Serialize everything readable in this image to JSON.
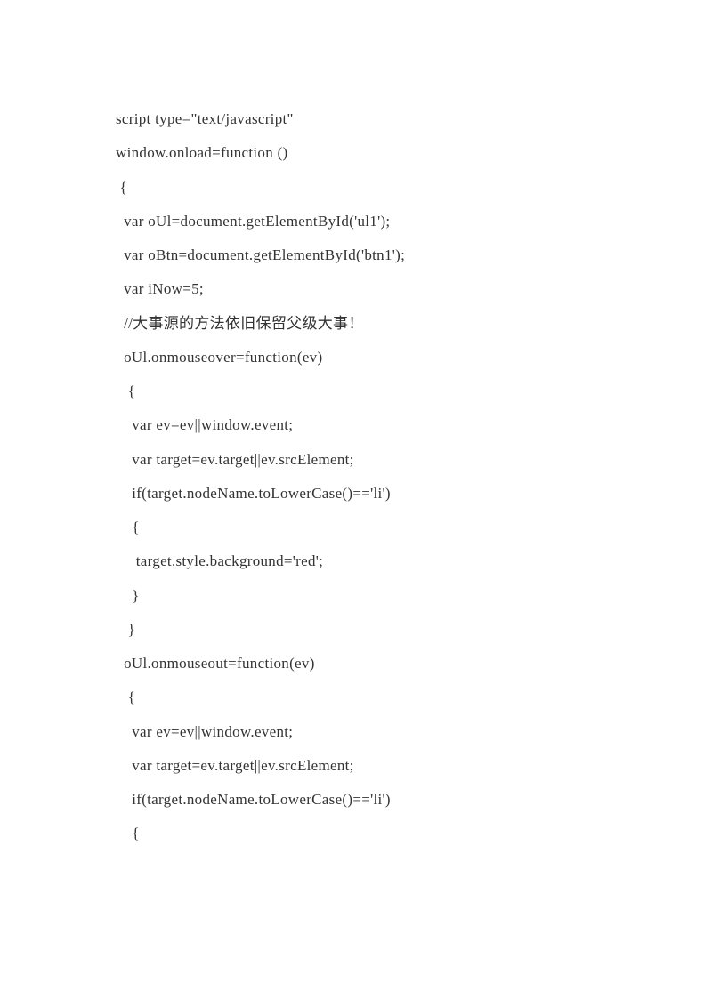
{
  "code": {
    "lines": [
      "script type=\"text/javascript\"",
      "window.onload=function ()",
      " {",
      "  var oUl=document.getElementById('ul1');",
      "  var oBtn=document.getElementById('btn1');",
      "  var iNow=5;",
      "  //大事源的方法依旧保留父级大事！",
      "  oUl.onmouseover=function(ev)",
      "   {",
      "    var ev=ev||window.event;",
      "    var target=ev.target||ev.srcElement;",
      "    if(target.nodeName.toLowerCase()=='li')",
      "    {",
      "     target.style.background='red';",
      "    }",
      "   }",
      "  oUl.onmouseout=function(ev)",
      "   {",
      "    var ev=ev||window.event;",
      "    var target=ev.target||ev.srcElement;",
      "    if(target.nodeName.toLowerCase()=='li')",
      "    {"
    ]
  }
}
